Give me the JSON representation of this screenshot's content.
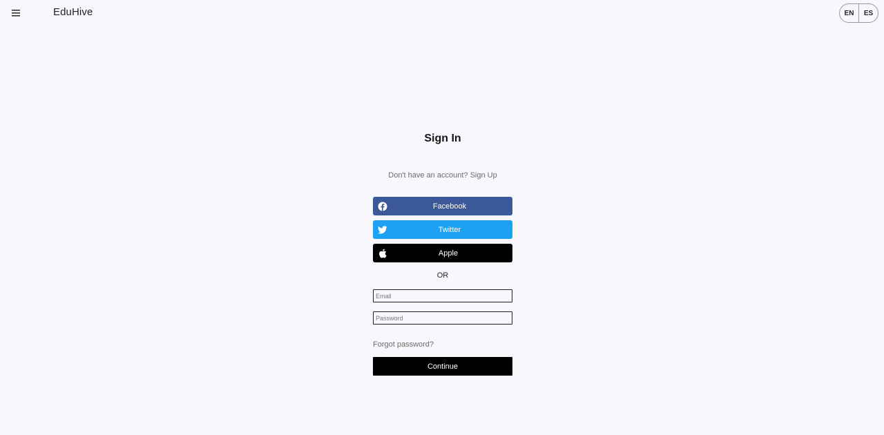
{
  "header": {
    "menu_icon": "hamburger-menu-icon",
    "brand": "EduHive",
    "languages": [
      "EN",
      "ES"
    ]
  },
  "auth": {
    "title": "Sign In",
    "signup_prompt": "Don't have an account?",
    "signup_link": "Sign Up",
    "social": [
      {
        "label": "Facebook",
        "icon": "facebook-icon",
        "color": "#3b5998"
      },
      {
        "label": "Twitter",
        "icon": "twitter-icon",
        "color": "#1da1f2"
      },
      {
        "label": "Apple",
        "icon": "apple-icon",
        "color": "#000000"
      }
    ],
    "divider": "OR",
    "email_placeholder": "Email",
    "password_placeholder": "Password",
    "forgot_password": "Forgot password?",
    "continue": "Continue"
  }
}
